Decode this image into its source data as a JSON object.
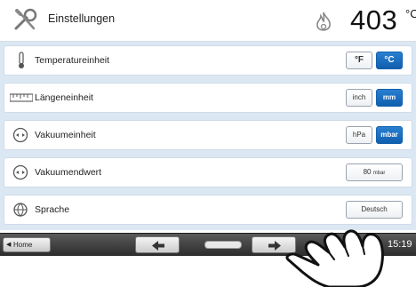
{
  "header": {
    "title": "Einstellungen",
    "temperature": "403",
    "temperature_unit": "°C",
    "icon": "tools-icon",
    "status_icon": "flame-icon"
  },
  "settings": [
    {
      "label": "Temperatureinheit",
      "icon": "thermometer-icon",
      "options": [
        "°F",
        "°C"
      ],
      "selected": "°C"
    },
    {
      "label": "Längeneinheit",
      "icon": "ruler-icon",
      "options": [
        "inch",
        "mm"
      ],
      "selected": "mm"
    },
    {
      "label": "Vakuumeinheit",
      "icon": "vacuum-gauge-icon",
      "options": [
        "hPa",
        "mbar"
      ],
      "selected": "mbar"
    },
    {
      "label": "Vakuumendwert",
      "icon": "vacuum-gauge-icon",
      "value": "80",
      "unit": "mbar"
    },
    {
      "label": "Sprache",
      "icon": "globe-icon",
      "value": "Deutsch"
    }
  ],
  "bottom_bar": {
    "home_label": "Home",
    "clock": "15:19"
  },
  "colors": {
    "accent": "#0f5fae",
    "list_background": "#dbe8f4",
    "bottom_bar": "#3a3a3a"
  }
}
